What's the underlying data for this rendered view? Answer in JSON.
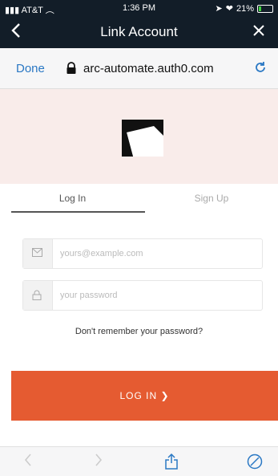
{
  "status_bar": {
    "carrier": "AT&T",
    "time": "1:36 PM",
    "battery": "21%",
    "battery_level": 0.21
  },
  "nav": {
    "title": "Link Account"
  },
  "url_bar": {
    "done_label": "Done",
    "url": "arc-automate.auth0.com"
  },
  "tabs": {
    "login": "Log In",
    "signup": "Sign Up"
  },
  "form": {
    "email_placeholder": "yours@example.com",
    "email_value": "",
    "password_placeholder": "your password",
    "password_value": "",
    "forgot_label": "Don't remember your password?"
  },
  "login_button": {
    "label": "LOG IN ❯"
  },
  "colors": {
    "nav_bg": "#121d28",
    "link": "#2a78c4",
    "accent": "#e55b31",
    "hero_bg": "#f9ecea"
  },
  "icons": {
    "back": "chevron-left-icon",
    "close": "close-icon",
    "lock": "lock-icon",
    "reload": "reload-icon",
    "email": "envelope-icon",
    "password": "lock-icon",
    "share": "share-icon",
    "compass": "compass-icon"
  }
}
